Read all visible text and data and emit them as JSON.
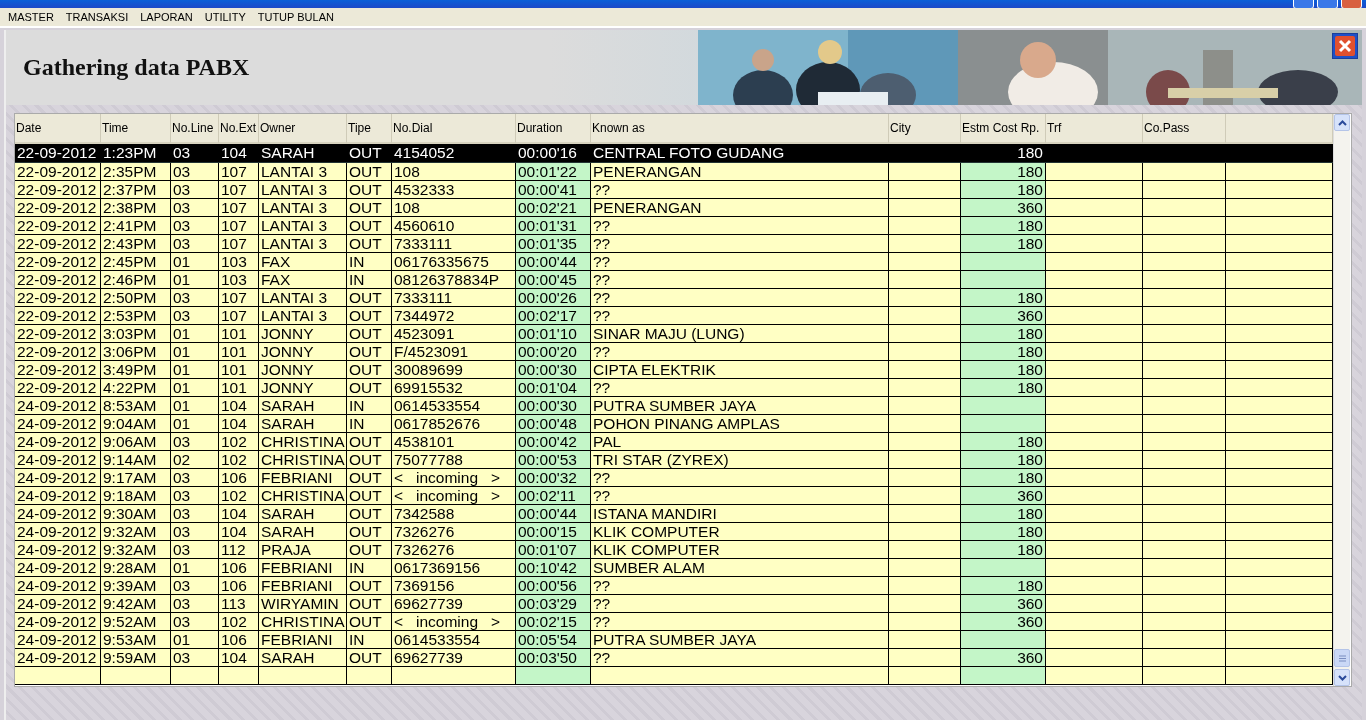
{
  "menu": [
    "MASTER",
    "TRANSAKSI",
    "LAPORAN",
    "UTILITY",
    "TUTUP BULAN"
  ],
  "header": {
    "title": "Gathering data PABX"
  },
  "table": {
    "columns": [
      "Date",
      "Time",
      "No.Line",
      "No.Ext",
      "Owner",
      "Tipe",
      "No.Dial",
      "Duration",
      "Known as",
      "City",
      "Estm Cost Rp.",
      "Trf",
      "Co.Pass"
    ],
    "rows": [
      {
        "date": "22-09-2012",
        "time": "1:23PM",
        "line": "03",
        "ext": "104",
        "owner": "SARAH",
        "tipe": "OUT",
        "dial": "4154052",
        "duration": "00:00'16",
        "known": "CENTRAL FOTO GUDANG",
        "cost": "180",
        "selected": true
      },
      {
        "date": "22-09-2012",
        "time": "2:35PM",
        "line": "03",
        "ext": "107",
        "owner": "LANTAI 3",
        "tipe": "OUT",
        "dial": "108",
        "duration": "00:01'22",
        "known": "PENERANGAN",
        "cost": "180",
        "selected": false
      },
      {
        "date": "22-09-2012",
        "time": "2:37PM",
        "line": "03",
        "ext": "107",
        "owner": "LANTAI 3",
        "tipe": "OUT",
        "dial": "4532333",
        "duration": "00:00'41",
        "known": "??",
        "cost": "180",
        "selected": false
      },
      {
        "date": "22-09-2012",
        "time": "2:38PM",
        "line": "03",
        "ext": "107",
        "owner": "LANTAI 3",
        "tipe": "OUT",
        "dial": "108",
        "duration": "00:02'21",
        "known": "PENERANGAN",
        "cost": "360",
        "selected": false
      },
      {
        "date": "22-09-2012",
        "time": "2:41PM",
        "line": "03",
        "ext": "107",
        "owner": "LANTAI 3",
        "tipe": "OUT",
        "dial": "4560610",
        "duration": "00:01'31",
        "known": "??",
        "cost": "180",
        "selected": false
      },
      {
        "date": "22-09-2012",
        "time": "2:43PM",
        "line": "03",
        "ext": "107",
        "owner": "LANTAI 3",
        "tipe": "OUT",
        "dial": "7333111",
        "duration": "00:01'35",
        "known": "??",
        "cost": "180",
        "selected": false
      },
      {
        "date": "22-09-2012",
        "time": "2:45PM",
        "line": "01",
        "ext": "103",
        "owner": "FAX",
        "tipe": "IN",
        "dial": "06176335675",
        "duration": "00:00'44",
        "known": "??",
        "selected": false
      },
      {
        "date": "22-09-2012",
        "time": "2:46PM",
        "line": "01",
        "ext": "103",
        "owner": "FAX",
        "tipe": "IN",
        "dial": "08126378834P",
        "duration": "00:00'45",
        "known": "??",
        "selected": false
      },
      {
        "date": "22-09-2012",
        "time": "2:50PM",
        "line": "03",
        "ext": "107",
        "owner": "LANTAI 3",
        "tipe": "OUT",
        "dial": "7333111",
        "duration": "00:00'26",
        "known": "??",
        "cost": "180",
        "selected": false
      },
      {
        "date": "22-09-2012",
        "time": "2:53PM",
        "line": "03",
        "ext": "107",
        "owner": "LANTAI 3",
        "tipe": "OUT",
        "dial": "7344972",
        "duration": "00:02'17",
        "known": "??",
        "cost": "360",
        "selected": false
      },
      {
        "date": "22-09-2012",
        "time": "3:03PM",
        "line": "01",
        "ext": "101",
        "owner": "JONNY",
        "tipe": "OUT",
        "dial": "4523091",
        "duration": "00:01'10",
        "known": "SINAR MAJU (LUNG)",
        "cost": "180",
        "selected": false
      },
      {
        "date": "22-09-2012",
        "time": "3:06PM",
        "line": "01",
        "ext": "101",
        "owner": "JONNY",
        "tipe": "OUT",
        "dial": "F/4523091",
        "duration": "00:00'20",
        "known": "??",
        "cost": "180",
        "selected": false
      },
      {
        "date": "22-09-2012",
        "time": "3:49PM",
        "line": "01",
        "ext": "101",
        "owner": "JONNY",
        "tipe": "OUT",
        "dial": "30089699",
        "duration": "00:00'30",
        "known": "CIPTA ELEKTRIK",
        "cost": "180",
        "selected": false
      },
      {
        "date": "22-09-2012",
        "time": "4:22PM",
        "line": "01",
        "ext": "101",
        "owner": "JONNY",
        "tipe": "OUT",
        "dial": "69915532",
        "duration": "00:01'04",
        "known": "??",
        "cost": "180",
        "selected": false
      },
      {
        "date": "24-09-2012",
        "time": "8:53AM",
        "line": "01",
        "ext": "104",
        "owner": "SARAH",
        "tipe": "IN",
        "dial": "0614533554",
        "duration": "00:00'30",
        "known": "PUTRA SUMBER JAYA",
        "selected": false
      },
      {
        "date": "24-09-2012",
        "time": "9:04AM",
        "line": "01",
        "ext": "104",
        "owner": "SARAH",
        "tipe": "IN",
        "dial": "0617852676",
        "duration": "00:00'48",
        "known": "POHON PINANG AMPLAS",
        "selected": false
      },
      {
        "date": "24-09-2012",
        "time": "9:06AM",
        "line": "03",
        "ext": "102",
        "owner": "CHRISTINA",
        "tipe": "OUT",
        "dial": "4538101",
        "duration": "00:00'42",
        "known": "PAL",
        "cost": "180",
        "selected": false
      },
      {
        "date": "24-09-2012",
        "time": "9:14AM",
        "line": "02",
        "ext": "102",
        "owner": "CHRISTINA",
        "tipe": "OUT",
        "dial": "75077788",
        "duration": "00:00'53",
        "known": "TRI STAR (ZYREX)",
        "cost": "180",
        "selected": false
      },
      {
        "date": "24-09-2012",
        "time": "9:17AM",
        "line": "03",
        "ext": "106",
        "owner": "FEBRIANI",
        "tipe": "OUT",
        "dial": "<   incoming   >",
        "duration": "00:00'32",
        "known": "??",
        "cost": "180",
        "selected": false
      },
      {
        "date": "24-09-2012",
        "time": "9:18AM",
        "line": "03",
        "ext": "102",
        "owner": "CHRISTINA",
        "tipe": "OUT",
        "dial": "<   incoming   >",
        "duration": "00:02'11",
        "known": "??",
        "cost": "360",
        "selected": false
      },
      {
        "date": "24-09-2012",
        "time": "9:30AM",
        "line": "03",
        "ext": "104",
        "owner": "SARAH",
        "tipe": "OUT",
        "dial": "7342588",
        "duration": "00:00'44",
        "known": "ISTANA MANDIRI",
        "cost": "180",
        "selected": false
      },
      {
        "date": "24-09-2012",
        "time": "9:32AM",
        "line": "03",
        "ext": "104",
        "owner": "SARAH",
        "tipe": "OUT",
        "dial": "7326276",
        "duration": "00:00'15",
        "known": "KLIK COMPUTER",
        "cost": "180",
        "selected": false
      },
      {
        "date": "24-09-2012",
        "time": "9:32AM",
        "line": "03",
        "ext": "112",
        "owner": "PRAJA",
        "tipe": "OUT",
        "dial": "7326276",
        "duration": "00:01'07",
        "known": "KLIK COMPUTER",
        "cost": "180",
        "selected": false
      },
      {
        "date": "24-09-2012",
        "time": "9:28AM",
        "line": "01",
        "ext": "106",
        "owner": "FEBRIANI",
        "tipe": "IN",
        "dial": "0617369156",
        "duration": "00:10'42",
        "known": "SUMBER ALAM",
        "selected": false
      },
      {
        "date": "24-09-2012",
        "time": "9:39AM",
        "line": "03",
        "ext": "106",
        "owner": "FEBRIANI",
        "tipe": "OUT",
        "dial": "7369156",
        "duration": "00:00'56",
        "known": "??",
        "cost": "180",
        "selected": false
      },
      {
        "date": "24-09-2012",
        "time": "9:42AM",
        "line": "03",
        "ext": "113",
        "owner": "WIRYAMIN",
        "tipe": "OUT",
        "dial": "69627739",
        "duration": "00:03'29",
        "known": "??",
        "cost": "360",
        "selected": false
      },
      {
        "date": "24-09-2012",
        "time": "9:52AM",
        "line": "03",
        "ext": "102",
        "owner": "CHRISTINA",
        "tipe": "OUT",
        "dial": "<   incoming   >",
        "duration": "00:02'15",
        "known": "??",
        "cost": "360",
        "selected": false
      },
      {
        "date": "24-09-2012",
        "time": "9:53AM",
        "line": "01",
        "ext": "106",
        "owner": "FEBRIANI",
        "tipe": "IN",
        "dial": "0614533554",
        "duration": "00:05'54",
        "known": "PUTRA SUMBER JAYA",
        "selected": false
      },
      {
        "date": "24-09-2012",
        "time": "9:59AM",
        "line": "03",
        "ext": "104",
        "owner": "SARAH",
        "tipe": "OUT",
        "dial": "69627739",
        "duration": "00:03'50",
        "known": "??",
        "cost": "360",
        "selected": false
      }
    ]
  }
}
